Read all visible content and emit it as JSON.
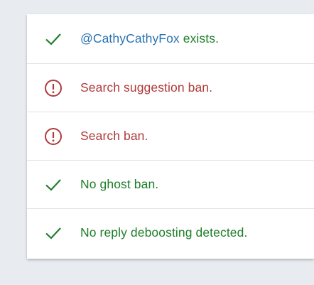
{
  "colors": {
    "success": "#1e7e2a",
    "error": "#b03a3a",
    "link": "#2a73b0",
    "background": "#e8ecf0",
    "card": "#ffffff"
  },
  "results": [
    {
      "status": "ok",
      "icon": "check-icon",
      "handle": "@CathyCathyFox",
      "text": " exists."
    },
    {
      "status": "bad",
      "icon": "alert-circle-icon",
      "text": "Search suggestion ban."
    },
    {
      "status": "bad",
      "icon": "alert-circle-icon",
      "text": "Search ban."
    },
    {
      "status": "ok",
      "icon": "check-icon",
      "text": "No ghost ban."
    },
    {
      "status": "ok",
      "icon": "check-icon",
      "text": "No reply deboosting detected."
    }
  ]
}
